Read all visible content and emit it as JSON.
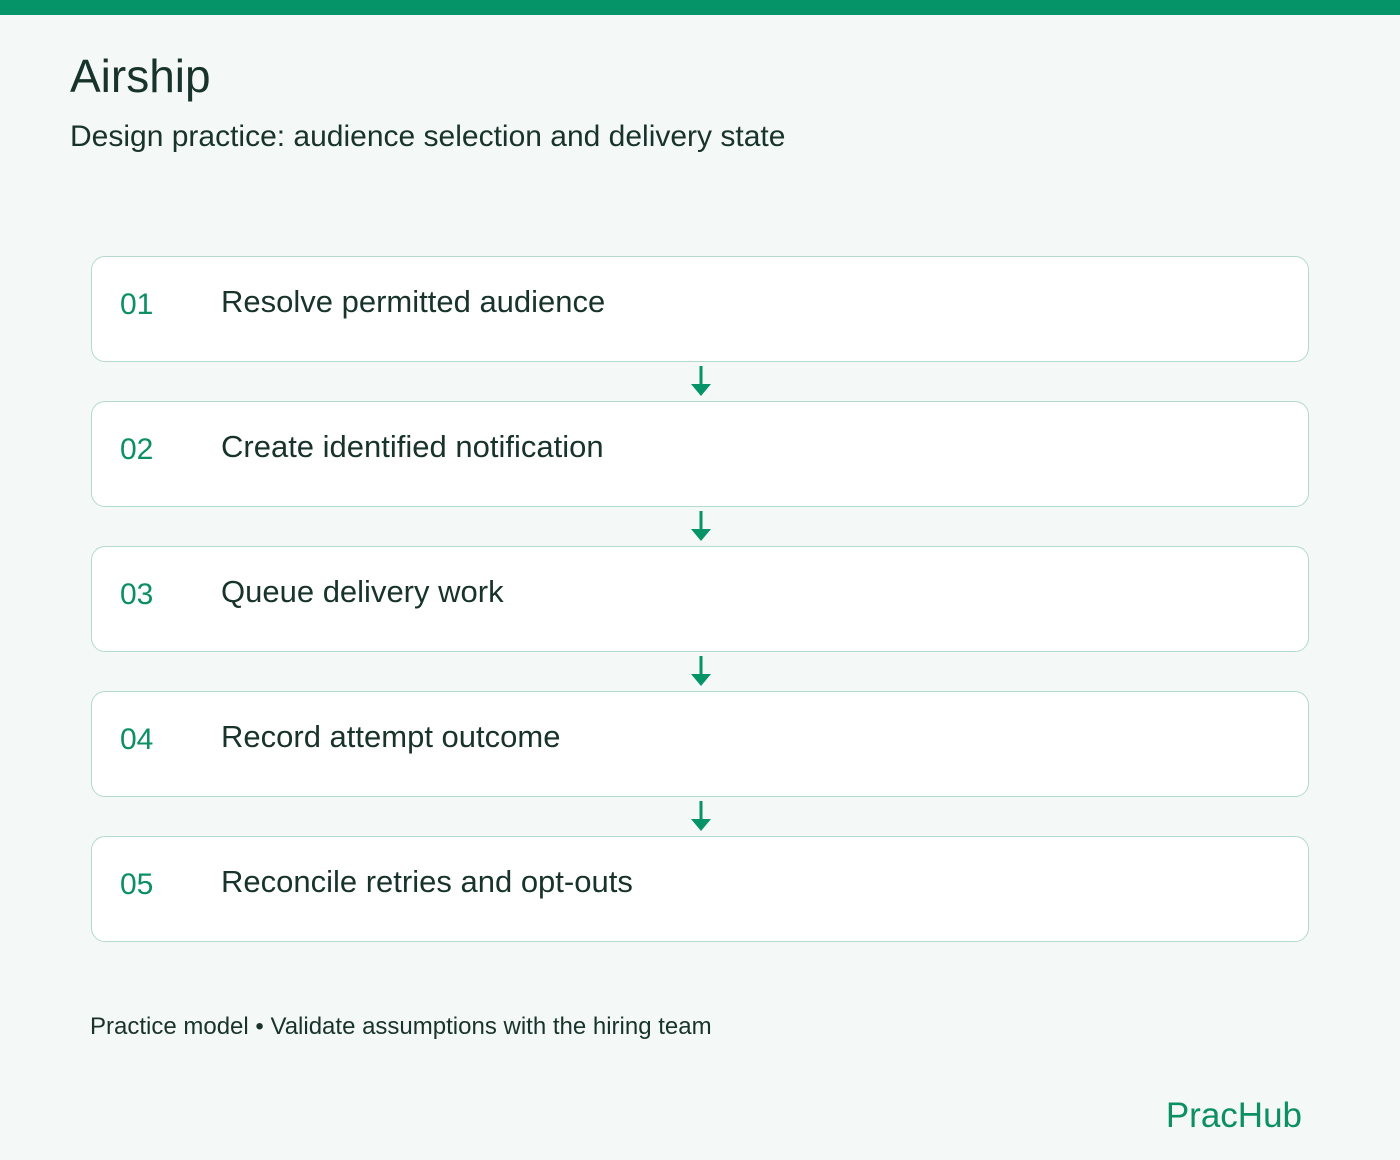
{
  "header": {
    "title": "Airship",
    "subtitle": "Design practice: audience selection and delivery state"
  },
  "steps": [
    {
      "number": "01",
      "label": "Resolve permitted audience"
    },
    {
      "number": "02",
      "label": "Create identified notification"
    },
    {
      "number": "03",
      "label": "Queue delivery work"
    },
    {
      "number": "04",
      "label": "Record attempt outcome"
    },
    {
      "number": "05",
      "label": "Reconcile retries and opt-outs"
    }
  ],
  "footer": {
    "note": "Practice model • Validate assumptions with the hiring team",
    "brand": "PracHub"
  },
  "colors": {
    "accent": "#049467",
    "card_border": "#b3dacb",
    "text": "#17332b",
    "background": "#f4f8f6"
  }
}
